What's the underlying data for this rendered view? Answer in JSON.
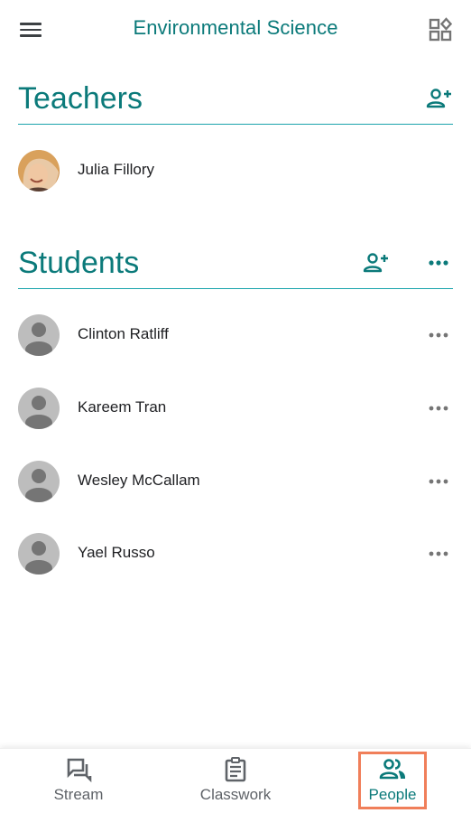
{
  "header": {
    "title": "Environmental Science",
    "menu_icon": "hamburger-menu-icon",
    "apps_icon": "class-apps-icon"
  },
  "teachers": {
    "title": "Teachers",
    "add_icon": "person-add-icon",
    "items": [
      {
        "name": "Julia Fillory",
        "avatar": "photo"
      }
    ]
  },
  "students": {
    "title": "Students",
    "add_icon": "person-add-icon",
    "more_icon": "more-horizontal-icon",
    "items": [
      {
        "name": "Clinton Ratliff",
        "avatar": "default"
      },
      {
        "name": "Kareem Tran",
        "avatar": "default"
      },
      {
        "name": "Wesley McCallam",
        "avatar": "default"
      },
      {
        "name": "Yael Russo",
        "avatar": "default"
      }
    ]
  },
  "bottom_nav": {
    "items": [
      {
        "label": "Stream",
        "icon": "stream-icon",
        "active": false
      },
      {
        "label": "Classwork",
        "icon": "classwork-icon",
        "active": false
      },
      {
        "label": "People",
        "icon": "people-icon",
        "active": true
      }
    ]
  },
  "colors": {
    "accent": "#0b7a7a",
    "divider": "#1ba4ad",
    "highlight": "#f07f5a"
  }
}
